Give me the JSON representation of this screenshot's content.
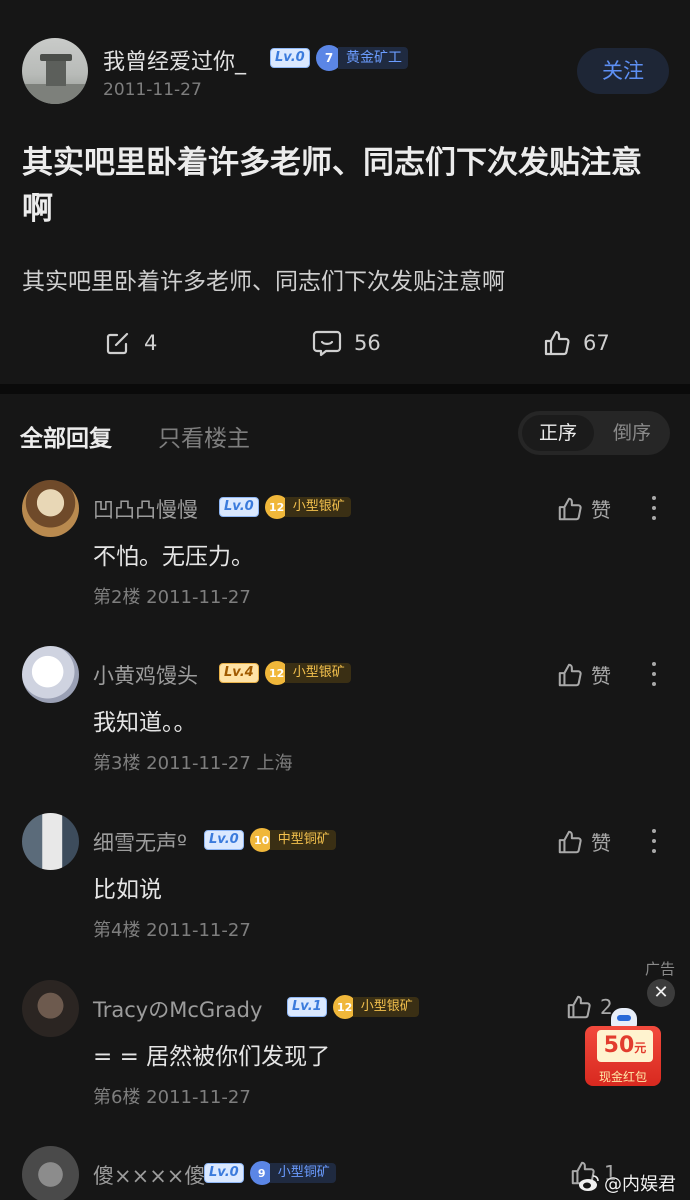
{
  "post": {
    "author": "我曾经爱过你_",
    "level": "Lv.0",
    "badge_level": "7",
    "badge_name": "黄金矿工",
    "date": "2011-11-27",
    "follow_label": "关注",
    "title": "其实吧里卧着许多老师、同志们下次发贴注意啊",
    "body": "其实吧里卧着许多老师、同志们下次发贴注意啊",
    "shares": "4",
    "comments": "56",
    "likes": "67"
  },
  "replies_header": {
    "tab_all": "全部回复",
    "tab_op": "只看楼主",
    "sort_asc": "正序",
    "sort_desc": "倒序"
  },
  "replies": [
    {
      "name": "凹凸凸慢慢",
      "level": "Lv.0",
      "badge_level": "12",
      "badge_name": "小型银矿",
      "text": "不怕。无压力。",
      "meta": "第2楼 2011-11-27",
      "like_label": "赞"
    },
    {
      "name": "小黄鸡馒头",
      "level": "Lv.4",
      "badge_level": "12",
      "badge_name": "小型银矿",
      "text": "我知道。。",
      "meta": "第3楼 2011-11-27 上海",
      "like_label": "赞"
    },
    {
      "name": "细雪无声º",
      "level": "Lv.0",
      "badge_level": "10",
      "badge_name": "中型铜矿",
      "text": "比如说",
      "meta": "第4楼 2011-11-27",
      "like_label": "赞"
    },
    {
      "name": "TracyのMcGrady",
      "level": "Lv.1",
      "badge_level": "12",
      "badge_name": "小型银矿",
      "text": "= = 居然被你们发现了",
      "meta": "第6楼 2011-11-27",
      "like_label": "2"
    },
    {
      "name": "傻××××傻",
      "level": "Lv.0",
      "badge_level": "9",
      "badge_name": "小型铜矿",
      "text": "",
      "meta": "",
      "like_label": "1"
    }
  ],
  "ad": {
    "label": "广告",
    "close": "✕",
    "amount": "50",
    "unit": "元",
    "caption": "现金红包"
  },
  "watermark": "@内娱君",
  "colors": {
    "background": "#161616",
    "accent_blue": "#5d8ff3",
    "silver_badge": "#f3c04d",
    "gold_badge": "#6b9cff"
  }
}
